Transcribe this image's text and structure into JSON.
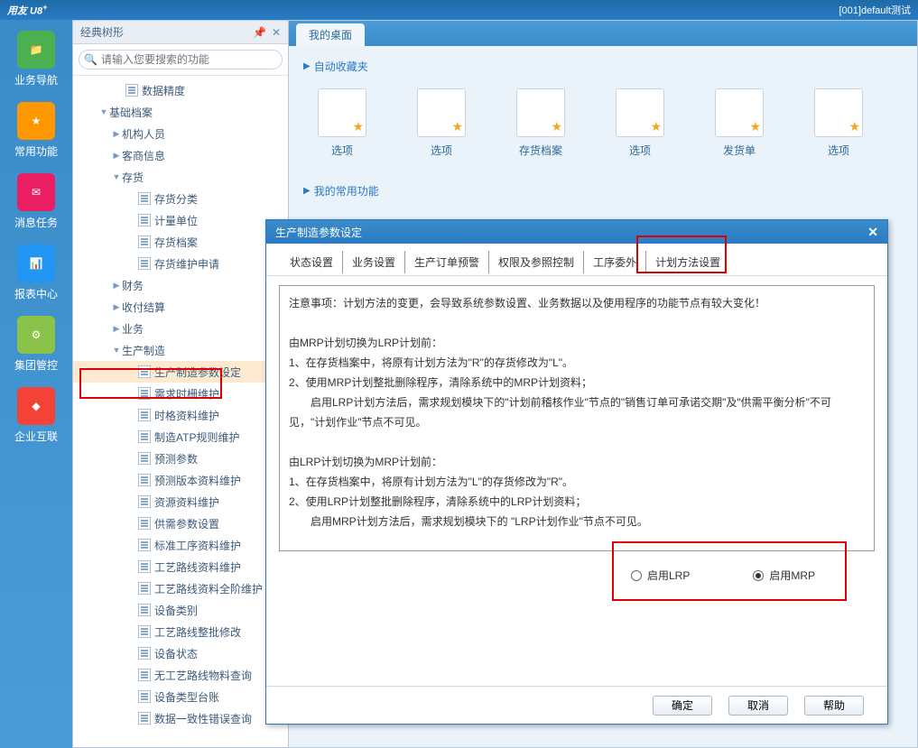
{
  "title_left": "用友 U8",
  "title_sup": "+",
  "title_right": "[001]default测试",
  "left_sidebar": [
    {
      "label": "业务导航"
    },
    {
      "label": "常用功能"
    },
    {
      "label": "消息任务"
    },
    {
      "label": "报表中心"
    },
    {
      "label": "集团管控"
    },
    {
      "label": "企业互联"
    }
  ],
  "tree": {
    "header": "经典树形",
    "search_placeholder": "请输入您要搜索的功能",
    "nodes": [
      {
        "lvl": 3,
        "icon": true,
        "label": "数据精度"
      },
      {
        "lvl": 2,
        "arrow": "down",
        "label": "基础档案"
      },
      {
        "lvl": 3,
        "arrow": "right",
        "label": "机构人员"
      },
      {
        "lvl": 3,
        "arrow": "right",
        "label": "客商信息"
      },
      {
        "lvl": 3,
        "arrow": "down",
        "label": "存货"
      },
      {
        "lvl": 4,
        "icon": true,
        "label": "存货分类"
      },
      {
        "lvl": 4,
        "icon": true,
        "label": "计量单位"
      },
      {
        "lvl": 4,
        "icon": true,
        "label": "存货档案"
      },
      {
        "lvl": 4,
        "icon": true,
        "label": "存货维护申请"
      },
      {
        "lvl": 3,
        "arrow": "right",
        "label": "财务"
      },
      {
        "lvl": 3,
        "arrow": "right",
        "label": "收付结算"
      },
      {
        "lvl": 3,
        "arrow": "right",
        "label": "业务"
      },
      {
        "lvl": 3,
        "arrow": "down",
        "label": "生产制造"
      },
      {
        "lvl": 4,
        "icon": true,
        "label": "生产制造参数设定",
        "selected": true
      },
      {
        "lvl": 4,
        "icon": true,
        "label": "需求时栅维护"
      },
      {
        "lvl": 4,
        "icon": true,
        "label": "时格资料维护"
      },
      {
        "lvl": 4,
        "icon": true,
        "label": "制造ATP规则维护"
      },
      {
        "lvl": 4,
        "icon": true,
        "label": "预测参数"
      },
      {
        "lvl": 4,
        "icon": true,
        "label": "预测版本资料维护"
      },
      {
        "lvl": 4,
        "icon": true,
        "label": "资源资料维护"
      },
      {
        "lvl": 4,
        "icon": true,
        "label": "供需参数设置"
      },
      {
        "lvl": 4,
        "icon": true,
        "label": "标准工序资料维护"
      },
      {
        "lvl": 4,
        "icon": true,
        "label": "工艺路线资料维护"
      },
      {
        "lvl": 4,
        "icon": true,
        "label": "工艺路线资料全阶维护"
      },
      {
        "lvl": 4,
        "icon": true,
        "label": "设备类别"
      },
      {
        "lvl": 4,
        "icon": true,
        "label": "工艺路线整批修改"
      },
      {
        "lvl": 4,
        "icon": true,
        "label": "设备状态"
      },
      {
        "lvl": 4,
        "icon": true,
        "label": "无工艺路线物料查询"
      },
      {
        "lvl": 4,
        "icon": true,
        "label": "设备类型台账"
      },
      {
        "lvl": 4,
        "icon": true,
        "label": "数据一致性错误查询"
      }
    ]
  },
  "content": {
    "tab": "我的桌面",
    "section1": "自动收藏夹",
    "tiles": [
      {
        "label": "选项"
      },
      {
        "label": "选项"
      },
      {
        "label": "存货档案"
      },
      {
        "label": "选项"
      },
      {
        "label": "发货单"
      },
      {
        "label": "选项"
      }
    ],
    "section2": "我的常用功能"
  },
  "dialog": {
    "title": "生产制造参数设定",
    "tabs": [
      "状态设置",
      "业务设置",
      "生产订单预警",
      "权限及参照控制",
      "工序委外",
      "计划方法设置"
    ],
    "body": {
      "l1": "注意事项：计划方法的变更，会导致系统参数设置、业务数据以及使用程序的功能节点有较大变化！",
      "l2": "由MRP计划切换为LRP计划前：",
      "l3": "1、在存货档案中，将原有计划方法为\"R\"的存货修改为\"L\"。",
      "l4": "2、使用MRP计划整批删除程序，清除系统中的MRP计划资料；",
      "l5": "　　启用LRP计划方法后，需求规划模块下的\"计划前稽核作业\"节点的\"销售订单可承诺交期\"及\"供需平衡分析\"不可见，\"计划作业\"节点不可见。",
      "l6": "由LRP计划切换为MRP计划前：",
      "l7": "1、在存货档案中，将原有计划方法为\"L\"的存货修改为\"R\"。",
      "l8": "2、使用LRP计划整批删除程序，清除系统中的LRP计划资料；",
      "l9": "　　启用MRP计划方法后，需求规划模块下的 \"LRP计划作业\"节点不可见。"
    },
    "radio1": "启用LRP",
    "radio2": "启用MRP",
    "btn_ok": "确定",
    "btn_cancel": "取消",
    "btn_help": "帮助"
  }
}
